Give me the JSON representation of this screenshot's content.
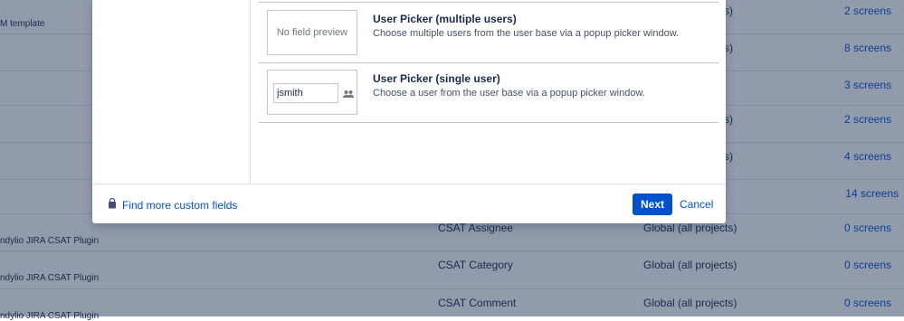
{
  "background_table": {
    "rows": [
      {
        "description": "M template",
        "name": "",
        "context": "s)",
        "screens": "2 screens"
      },
      {
        "description": "",
        "name": "",
        "context": "s)",
        "screens": "8 screens"
      },
      {
        "description": "",
        "name": "",
        "context": "",
        "screens": "3 screens"
      },
      {
        "description": "",
        "name": "",
        "context": "s)",
        "screens": "2 screens"
      },
      {
        "description": "",
        "name": "",
        "context": "s)",
        "screens": "4 screens"
      },
      {
        "description": "",
        "name": "",
        "context": "",
        "screens": "14 screens"
      },
      {
        "description": "ndylio JIRA CSAT Plugin",
        "name": "CSAT Assignee",
        "context": "Global (all projects)",
        "screens": "0 screens"
      },
      {
        "description": "ndylio JIRA CSAT Plugin",
        "name": "CSAT Category",
        "context": "Global (all projects)",
        "screens": "0 screens"
      },
      {
        "description": "ndylio JIRA CSAT Plugin",
        "name": "CSAT Comment",
        "context": "Global (all projects)",
        "screens": "0 screens"
      }
    ]
  },
  "modal": {
    "fields": [
      {
        "title": "User Picker (multiple users)",
        "description": "Choose multiple users from the user base via a popup picker window.",
        "preview_text": "No field preview"
      },
      {
        "title": "User Picker (single user)",
        "description": "Choose a user from the user base via a popup picker window.",
        "preview_input_value": "jsmith",
        "preview_icon": "users-icon"
      }
    ],
    "footer": {
      "find_more_label": "Find more custom fields",
      "find_more_icon": "shopping-bag-icon",
      "next_label": "Next",
      "cancel_label": "Cancel"
    }
  },
  "colors": {
    "primary": "#0052cc",
    "text": "#172b4d",
    "overlay": "#172b4d"
  }
}
